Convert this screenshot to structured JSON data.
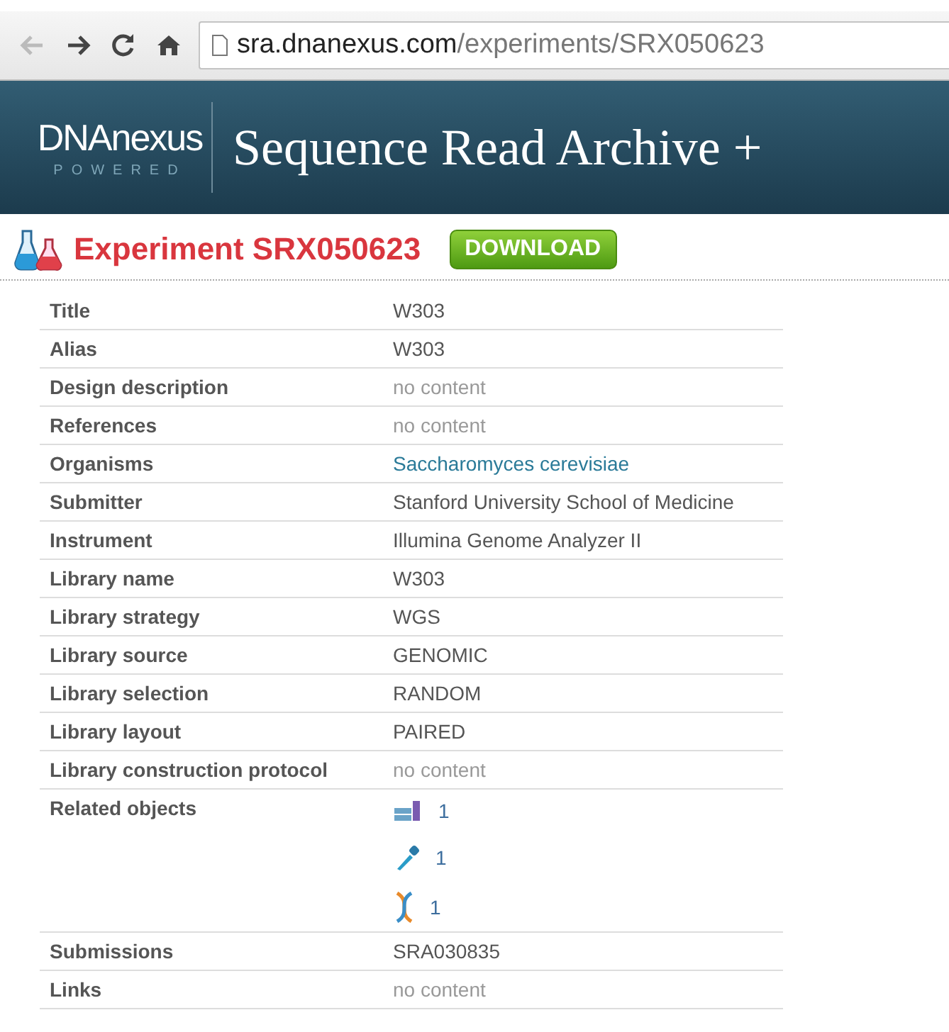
{
  "browser": {
    "url_host": "sra.dnanexus.com",
    "url_path": "/experiments/SRX050623",
    "back_disabled": true
  },
  "header": {
    "logo": "DNAnexus",
    "logo_tagline": "POWERED",
    "title": "Sequence Read Archive +"
  },
  "page": {
    "heading": "Experiment SRX050623",
    "download_button": "DOWNLOAD"
  },
  "rows": [
    {
      "label": "Title",
      "kind": "text",
      "value": "W303"
    },
    {
      "label": "Alias",
      "kind": "text",
      "value": "W303"
    },
    {
      "label": "Design description",
      "kind": "empty",
      "value": "no content"
    },
    {
      "label": "References",
      "kind": "empty",
      "value": "no content"
    },
    {
      "label": "Organisms",
      "kind": "link",
      "value": "Saccharomyces cerevisiae"
    },
    {
      "label": "Submitter",
      "kind": "text",
      "value": "Stanford University School of Medicine"
    },
    {
      "label": "Instrument",
      "kind": "text",
      "value": "Illumina Genome Analyzer II"
    },
    {
      "label": "Library name",
      "kind": "text",
      "value": "W303"
    },
    {
      "label": "Library strategy",
      "kind": "text",
      "value": "WGS"
    },
    {
      "label": "Library source",
      "kind": "text",
      "value": "GENOMIC"
    },
    {
      "label": "Library selection",
      "kind": "text",
      "value": "RANDOM"
    },
    {
      "label": "Library layout",
      "kind": "text",
      "value": "PAIRED"
    },
    {
      "label": "Library construction protocol",
      "kind": "empty",
      "value": "no content"
    },
    {
      "label": "Related objects",
      "kind": "related",
      "items": [
        {
          "kind": "books",
          "count": "1"
        },
        {
          "kind": "pipette",
          "count": "1"
        },
        {
          "kind": "dna",
          "count": "1"
        }
      ]
    },
    {
      "label": "Submissions",
      "kind": "text",
      "value": "SRA030835"
    },
    {
      "label": "Links",
      "kind": "empty",
      "value": "no content"
    }
  ]
}
